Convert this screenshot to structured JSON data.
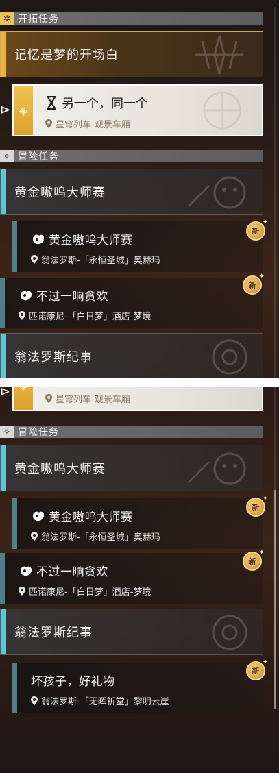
{
  "top_panel": {
    "trailblaze_header": {
      "label": "开拓任务",
      "icon": "trailblaze-diamond-icon"
    },
    "trailblaze_group": {
      "title": "记忆是梦的开场白"
    },
    "selected_mission": {
      "title": "另一个，同一个",
      "location": "星穹列车-观景车厢",
      "icon": "hourglass-icon"
    },
    "adventure_header": {
      "label": "冒险任务",
      "icon": "adventure-star-icon"
    },
    "group_golden": {
      "title": "黄金嗷呜大师赛"
    },
    "mission_golden": {
      "title": "黄金嗷呜大师赛",
      "location": "翁法罗斯-「永恒圣城」奥赫玛",
      "badge": "新",
      "icon": "mission-type-icon"
    },
    "mission_fleeting": {
      "title": "不过一晌贪欢",
      "location": "匹诺康尼-「白日梦」酒店-梦境",
      "badge": "新",
      "icon": "mission-type-icon"
    },
    "group_amphoreus": {
      "title": "翁法罗斯纪事"
    }
  },
  "bottom_panel": {
    "selected_fragment": {
      "location": "星穹列车-观景车厢"
    },
    "adventure_header": {
      "label": "冒险任务",
      "icon": "adventure-star-icon"
    },
    "group_golden": {
      "title": "黄金嗷呜大师赛"
    },
    "mission_golden": {
      "title": "黄金嗷呜大师赛",
      "location": "翁法罗斯-「永恒圣城」奥赫玛",
      "badge": "新",
      "icon": "mission-type-icon"
    },
    "mission_fleeting": {
      "title": "不过一晌贪欢",
      "location": "匹诺康尼-「白日梦」酒店-梦境",
      "badge": "新",
      "icon": "mission-type-icon"
    },
    "group_amphoreus": {
      "title": "翁法罗斯纪事"
    },
    "mission_badkid": {
      "title": "坏孩子，好礼物",
      "location": "翁法罗斯-「无晖祈堂」黎明云崖",
      "badge": "新"
    }
  },
  "colors": {
    "trailblaze_accent": "#e9b23e",
    "adventure_accent": "#5fc6d9",
    "mission_accent": "#4e7f8a",
    "new_badge": "#dca64a"
  }
}
